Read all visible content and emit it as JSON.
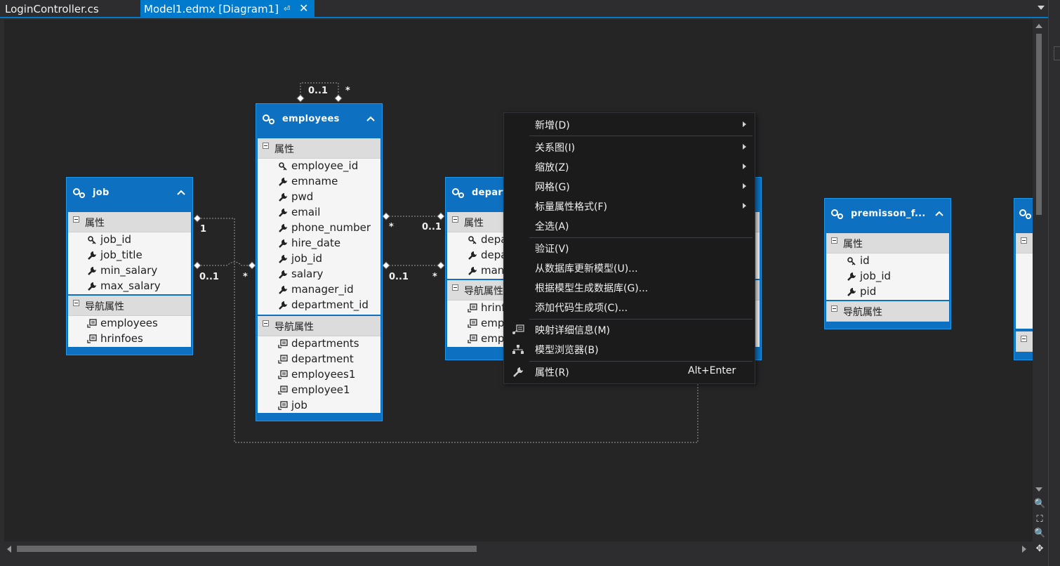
{
  "tabs": [
    {
      "label": "LoginController.cs",
      "active": false
    },
    {
      "label": "Model1.edmx [Diagram1]",
      "active": true
    }
  ],
  "entities": {
    "job": {
      "title": "job",
      "section_properties": "属性",
      "properties": [
        "job_id",
        "job_title",
        "min_salary",
        "max_salary"
      ],
      "section_nav": "导航属性",
      "nav": [
        "employees",
        "hrinfoes"
      ]
    },
    "employees": {
      "title": "employees",
      "section_properties": "属性",
      "properties": [
        "employee_id",
        "emname",
        "pwd",
        "email",
        "phone_number",
        "hire_date",
        "job_id",
        "salary",
        "manager_id",
        "department_id"
      ],
      "section_nav": "导航属性",
      "nav": [
        "departments",
        "department",
        "employees1",
        "employee1",
        "job"
      ]
    },
    "departments": {
      "title": "depart",
      "section_properties": "属性",
      "properties": [
        "depa",
        "depa",
        "man"
      ],
      "section_nav": "导航属性",
      "nav": [
        "hrinf",
        "emp",
        "emp"
      ]
    },
    "premisson": {
      "title": "premisson_f...",
      "section_properties": "属性",
      "properties": [
        "id",
        "job_id",
        "pid"
      ],
      "section_nav": "导航属性"
    }
  },
  "multiplicities": {
    "self_top_left": "0..1",
    "self_top_right": "*",
    "job_top_right": "1",
    "job_bottom_left": "0..1",
    "job_bottom_right": "*",
    "emp_dept_top_left": "*",
    "emp_dept_top_right": "0..1",
    "emp_dept_bottom_left": "0..1",
    "emp_dept_bottom_right": "*"
  },
  "context_menu": {
    "items": [
      {
        "label": "新增(D)",
        "submenu": true
      },
      {
        "label": "关系图(I)",
        "submenu": true
      },
      {
        "label": "缩放(Z)",
        "submenu": true
      },
      {
        "label": "网格(G)",
        "submenu": true
      },
      {
        "label": "标量属性格式(F)",
        "submenu": true
      },
      {
        "label": "全选(A)"
      },
      {
        "label": "验证(V)"
      },
      {
        "label": "从数据库更新模型(U)..."
      },
      {
        "label": "根据模型生成数据库(G)..."
      },
      {
        "label": "添加代码生成项(C)..."
      },
      {
        "label": "映射详细信息(M)",
        "icon": "mapping-details-icon"
      },
      {
        "label": "模型浏览器(B)",
        "icon": "model-browser-icon"
      },
      {
        "label": "属性(R)",
        "icon": "wrench-icon",
        "shortcut": "Alt+Enter"
      }
    ]
  },
  "colors": {
    "entity_header": "#0e70c0",
    "canvas": "#252526",
    "accent": "#007acc",
    "menu_bg": "#1b1b1c"
  }
}
